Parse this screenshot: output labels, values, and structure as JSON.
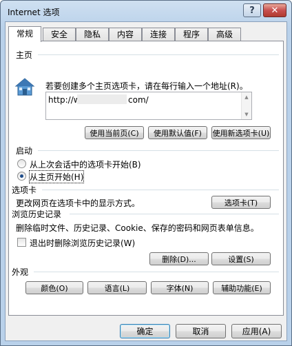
{
  "window": {
    "title": "Internet 选项",
    "help_glyph": "?",
    "close_glyph": "✕"
  },
  "tabs": [
    "常规",
    "安全",
    "隐私",
    "内容",
    "连接",
    "程序",
    "高级"
  ],
  "home": {
    "group_label": "主页",
    "description": "若要创建多个主页选项卡，请在每行输入一个地址(R)。",
    "url_prefix": "http://w",
    "url_suffix": "com/",
    "btn_current": "使用当前页(C)",
    "btn_default": "使用默认值(F)",
    "btn_newtab": "使用新选项卡(U)"
  },
  "startup": {
    "group_label": "启动",
    "option1": "从上次会话中的选项卡开始(B)",
    "option2": "从主页开始(H)",
    "selected": 2
  },
  "tabs_section": {
    "group_label": "选项卡",
    "description": "更改网页在选项卡中的显示方式。",
    "btn": "选项卡(T)"
  },
  "history": {
    "group_label": "浏览历史记录",
    "description": "删除临时文件、历史记录、Cookie、保存的密码和网页表单信息。",
    "checkbox_label": "退出时删除浏览历史记录(W)",
    "checked": false,
    "btn_delete": "删除(D)...",
    "btn_settings": "设置(S)"
  },
  "appearance": {
    "group_label": "外观",
    "btn_colors": "颜色(O)",
    "btn_languages": "语言(L)",
    "btn_fonts": "字体(N)",
    "btn_accessibility": "辅助功能(E)"
  },
  "footer": {
    "ok": "确定",
    "cancel": "取消",
    "apply": "应用(A)"
  },
  "colors": {
    "title_gradient": "#b9d1ea",
    "close_red": "#c75050",
    "divider": "#d5dfe5"
  }
}
